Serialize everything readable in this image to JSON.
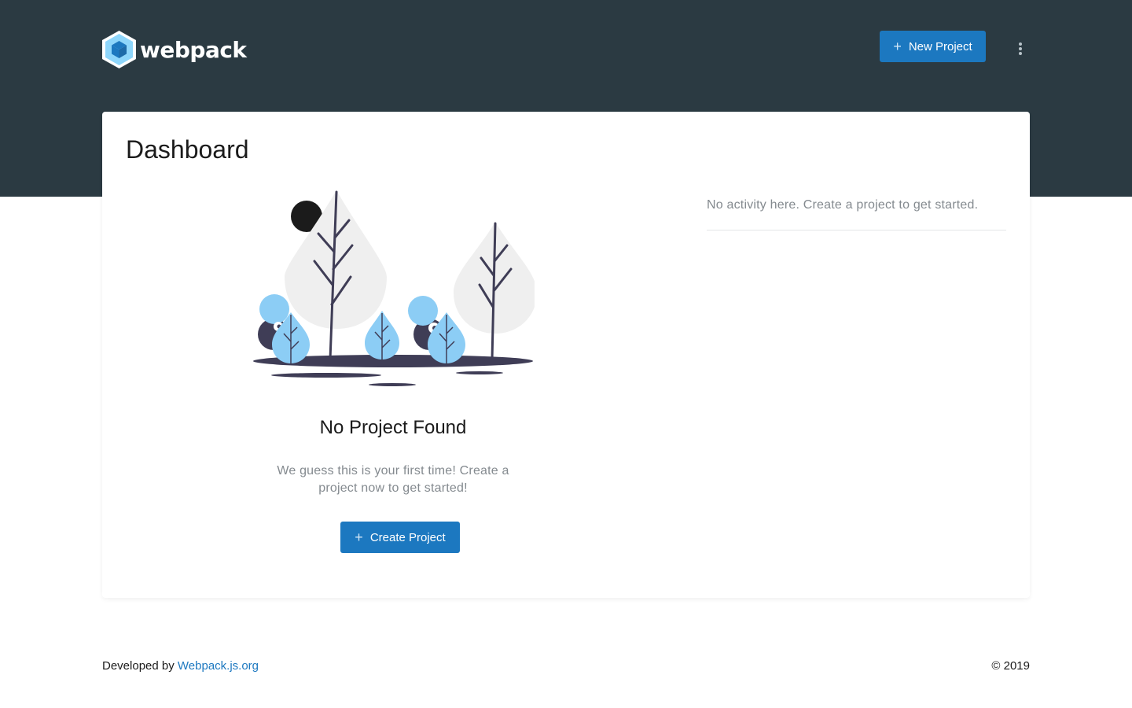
{
  "header": {
    "brand": "webpack",
    "new_project_label": "New Project",
    "more_menu_icon": "more-vertical-icon"
  },
  "dashboard": {
    "title": "Dashboard",
    "empty_state": {
      "title": "No Project Found",
      "description": "We guess this is your first time! Create a project now to get started!",
      "button_label": "Create Project"
    },
    "activity": {
      "empty_text": "No activity here. Create a project to get started."
    }
  },
  "footer": {
    "developed_by": "Developed by",
    "link_text": "Webpack.js.org",
    "copyright": "© 2019"
  },
  "colors": {
    "header_bg": "#2b3a42",
    "primary": "#1c78c0",
    "muted_text": "#848a8f",
    "illustration_accent": "#8ccdf5",
    "illustration_dark": "#3f3d56"
  }
}
